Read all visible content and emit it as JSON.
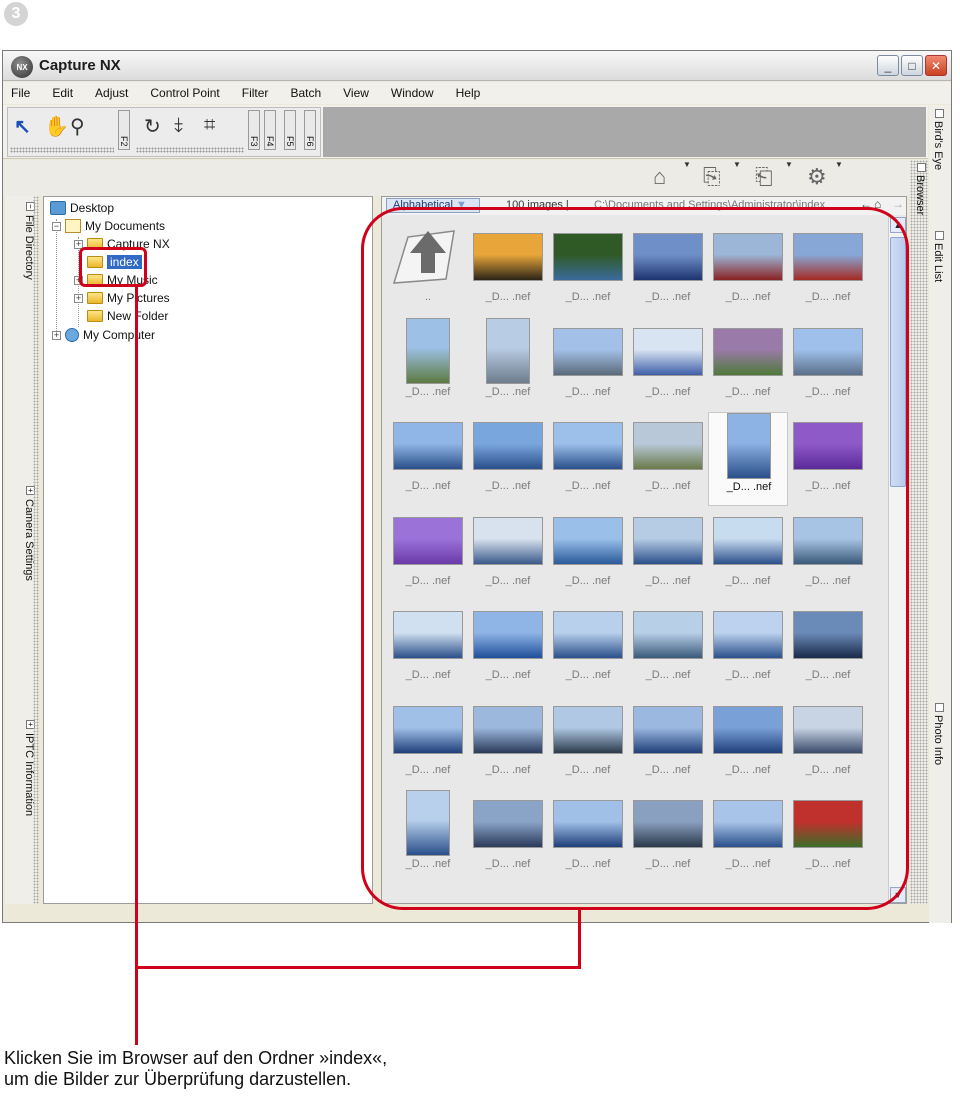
{
  "step_number": "3",
  "window": {
    "title": "Capture NX",
    "controls": [
      "_",
      "□",
      "✕"
    ]
  },
  "menu": [
    "File",
    "Edit",
    "Adjust",
    "Control Point",
    "Filter",
    "Batch",
    "View",
    "Window",
    "Help"
  ],
  "toolbar": {
    "function_keys": [
      "F2",
      "F3",
      "F4",
      "F5",
      "F6"
    ]
  },
  "left_tabs": [
    "File Directory",
    "Camera Settings",
    "IPTC Information"
  ],
  "right_tabs": [
    "Bird's Eye",
    "Edit List",
    "Photo Info"
  ],
  "browser_tab": "Browser",
  "tree": {
    "desktop": "Desktop",
    "my_documents": "My Documents",
    "capture_nx": "Capture NX",
    "index": "index",
    "my_music": "My Music",
    "my_pictures": "My Pictures",
    "new_folder": "New Folder",
    "my_computer": "My Computer"
  },
  "browser": {
    "sort": "Alphabetical",
    "image_count": "100 images |",
    "path": "C:\\Documents and Settings\\Administrator\\index",
    "parent_label": "..",
    "thumb_label": "_D... .nef"
  },
  "caption": "Klicken Sie im Browser auf den Ordner »index«,\num die Bilder zur Überprüfung darzustellen."
}
